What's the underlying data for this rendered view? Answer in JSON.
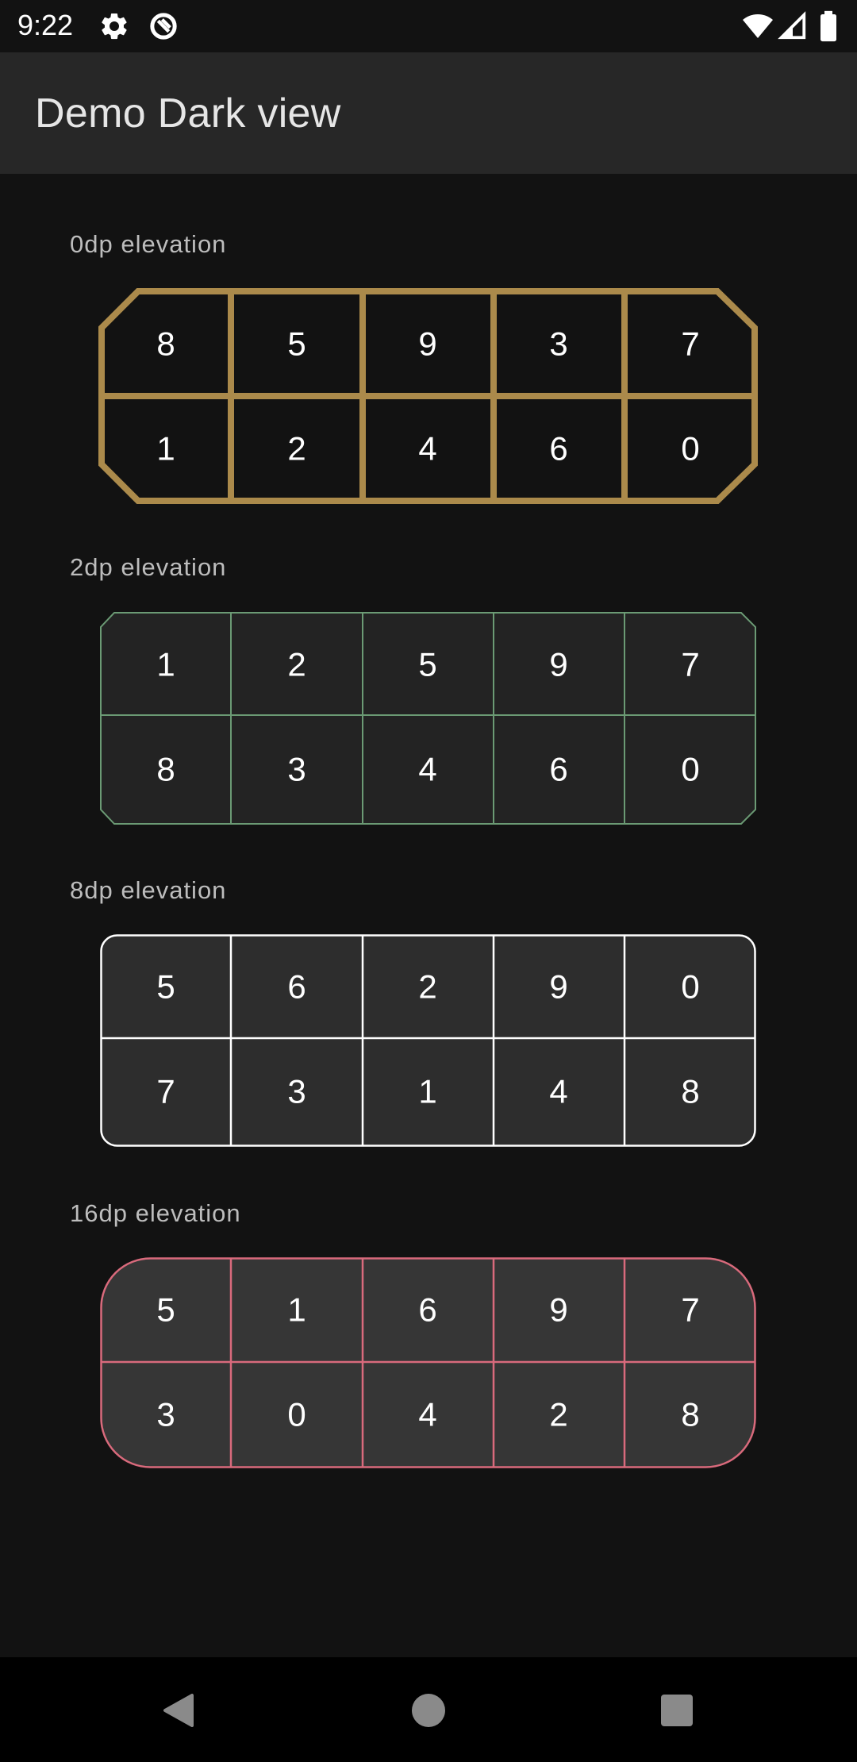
{
  "status_bar": {
    "time": "9:22",
    "icons_left": [
      "settings-icon",
      "data-saver-icon"
    ],
    "icons_right": [
      "wifi-icon",
      "cell-signal-icon",
      "battery-icon"
    ]
  },
  "app_bar": {
    "title": "Demo Dark view",
    "background": "#272727"
  },
  "sections": [
    {
      "label": "0dp elevation",
      "border_color": "#ab8a4b",
      "fill": "#121212",
      "shape": "cut-corner",
      "rows": [
        [
          "8",
          "5",
          "9",
          "3",
          "7"
        ],
        [
          "1",
          "2",
          "4",
          "6",
          "0"
        ]
      ]
    },
    {
      "label": "2dp elevation",
      "border_color": "#6b9a74",
      "fill": "#232323",
      "shape": "cut-corner",
      "rows": [
        [
          "1",
          "2",
          "5",
          "9",
          "7"
        ],
        [
          "8",
          "3",
          "4",
          "6",
          "0"
        ]
      ]
    },
    {
      "label": "8dp elevation",
      "border_color": "#ffffff",
      "fill": "#2d2d2d",
      "shape": "rounded",
      "rows": [
        [
          "5",
          "6",
          "2",
          "9",
          "0"
        ],
        [
          "7",
          "3",
          "1",
          "4",
          "8"
        ]
      ]
    },
    {
      "label": "16dp elevation",
      "border_color": "#d96a7c",
      "fill": "#363636",
      "shape": "rounded",
      "rows": [
        [
          "5",
          "1",
          "6",
          "9",
          "7"
        ],
        [
          "3",
          "0",
          "4",
          "2",
          "8"
        ]
      ]
    }
  ],
  "nav_bar": {
    "buttons": [
      "back-icon",
      "home-icon",
      "recents-icon"
    ]
  }
}
